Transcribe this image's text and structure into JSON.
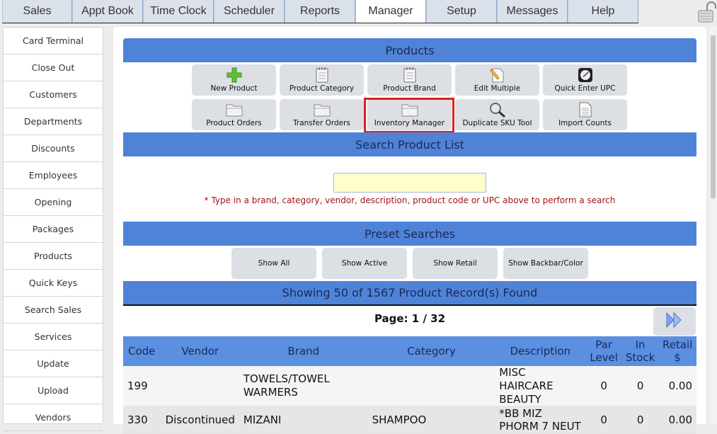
{
  "top_tabs": [
    {
      "label": "Sales",
      "active": false
    },
    {
      "label": "Appt Book",
      "active": false
    },
    {
      "label": "Time Clock",
      "active": false
    },
    {
      "label": "Scheduler",
      "active": false
    },
    {
      "label": "Reports",
      "active": false
    },
    {
      "label": "Manager",
      "active": true
    },
    {
      "label": "Setup",
      "active": false
    },
    {
      "label": "Messages",
      "active": false
    },
    {
      "label": "Help",
      "active": false
    }
  ],
  "lock_icon": "unlocked-padlock-icon",
  "sidebar": {
    "items": [
      {
        "label": "Card Terminal"
      },
      {
        "label": "Close Out"
      },
      {
        "label": "Customers"
      },
      {
        "label": "Departments"
      },
      {
        "label": "Discounts"
      },
      {
        "label": "Employees"
      },
      {
        "label": "Opening"
      },
      {
        "label": "Packages"
      },
      {
        "label": "Products"
      },
      {
        "label": "Quick Keys"
      },
      {
        "label": "Search Sales"
      },
      {
        "label": "Services"
      },
      {
        "label": "Update"
      },
      {
        "label": "Upload"
      },
      {
        "label": "Vendors"
      }
    ]
  },
  "products": {
    "title": "Products",
    "tools": [
      {
        "label": "New Product",
        "icon": "green-plus-icon"
      },
      {
        "label": "Product Category",
        "icon": "notepad-icon"
      },
      {
        "label": "Product Brand",
        "icon": "notepad-icon"
      },
      {
        "label": "Edit Multiple",
        "icon": "pencil-document-icon"
      },
      {
        "label": "Quick Enter UPC",
        "icon": "clock-icon"
      },
      {
        "label": "Product Orders",
        "icon": "folder-icon"
      },
      {
        "label": "Transfer Orders",
        "icon": "folder-icon"
      },
      {
        "label": "Inventory Manager",
        "icon": "folder-icon",
        "highlighted": true
      },
      {
        "label": "Duplicate SKU Tool",
        "icon": "magnifier-icon"
      },
      {
        "label": "Import Counts",
        "icon": "document-icon"
      }
    ]
  },
  "search": {
    "title": "Search Product List",
    "value": "",
    "placeholder": "",
    "hint": "* Type in a brand, category, vendor, description, product code or UPC above to perform a search"
  },
  "presets": {
    "title": "Preset Searches",
    "buttons": [
      "Show All",
      "Show Active",
      "Show Retail",
      "Show Backbar/Color"
    ]
  },
  "results": {
    "summary": "Showing 50 of 1567 Product Record(s) Found",
    "page_label": "Page: 1 / 32",
    "current_page": 1,
    "total_pages": 32,
    "next_icon": "double-chevron-right-icon",
    "columns": [
      "Code",
      "Vendor",
      "Brand",
      "Category",
      "Description",
      "Par Level",
      "In Stock",
      "Retail $"
    ],
    "rows": [
      {
        "code": "199",
        "vendor": "",
        "brand": "TOWELS/TOWEL WARMERS",
        "category": "",
        "description": "MISC HAIRCARE BEAUTY",
        "par_level": "0",
        "in_stock": "0",
        "retail": "0.00"
      },
      {
        "code": "330",
        "vendor": "Discontinued",
        "brand": "MIZANI",
        "category": "SHAMPOO",
        "description": "*BB MIZ PHORM 7 NEUT",
        "par_level": "0",
        "in_stock": "0",
        "retail": "0.00"
      }
    ]
  }
}
